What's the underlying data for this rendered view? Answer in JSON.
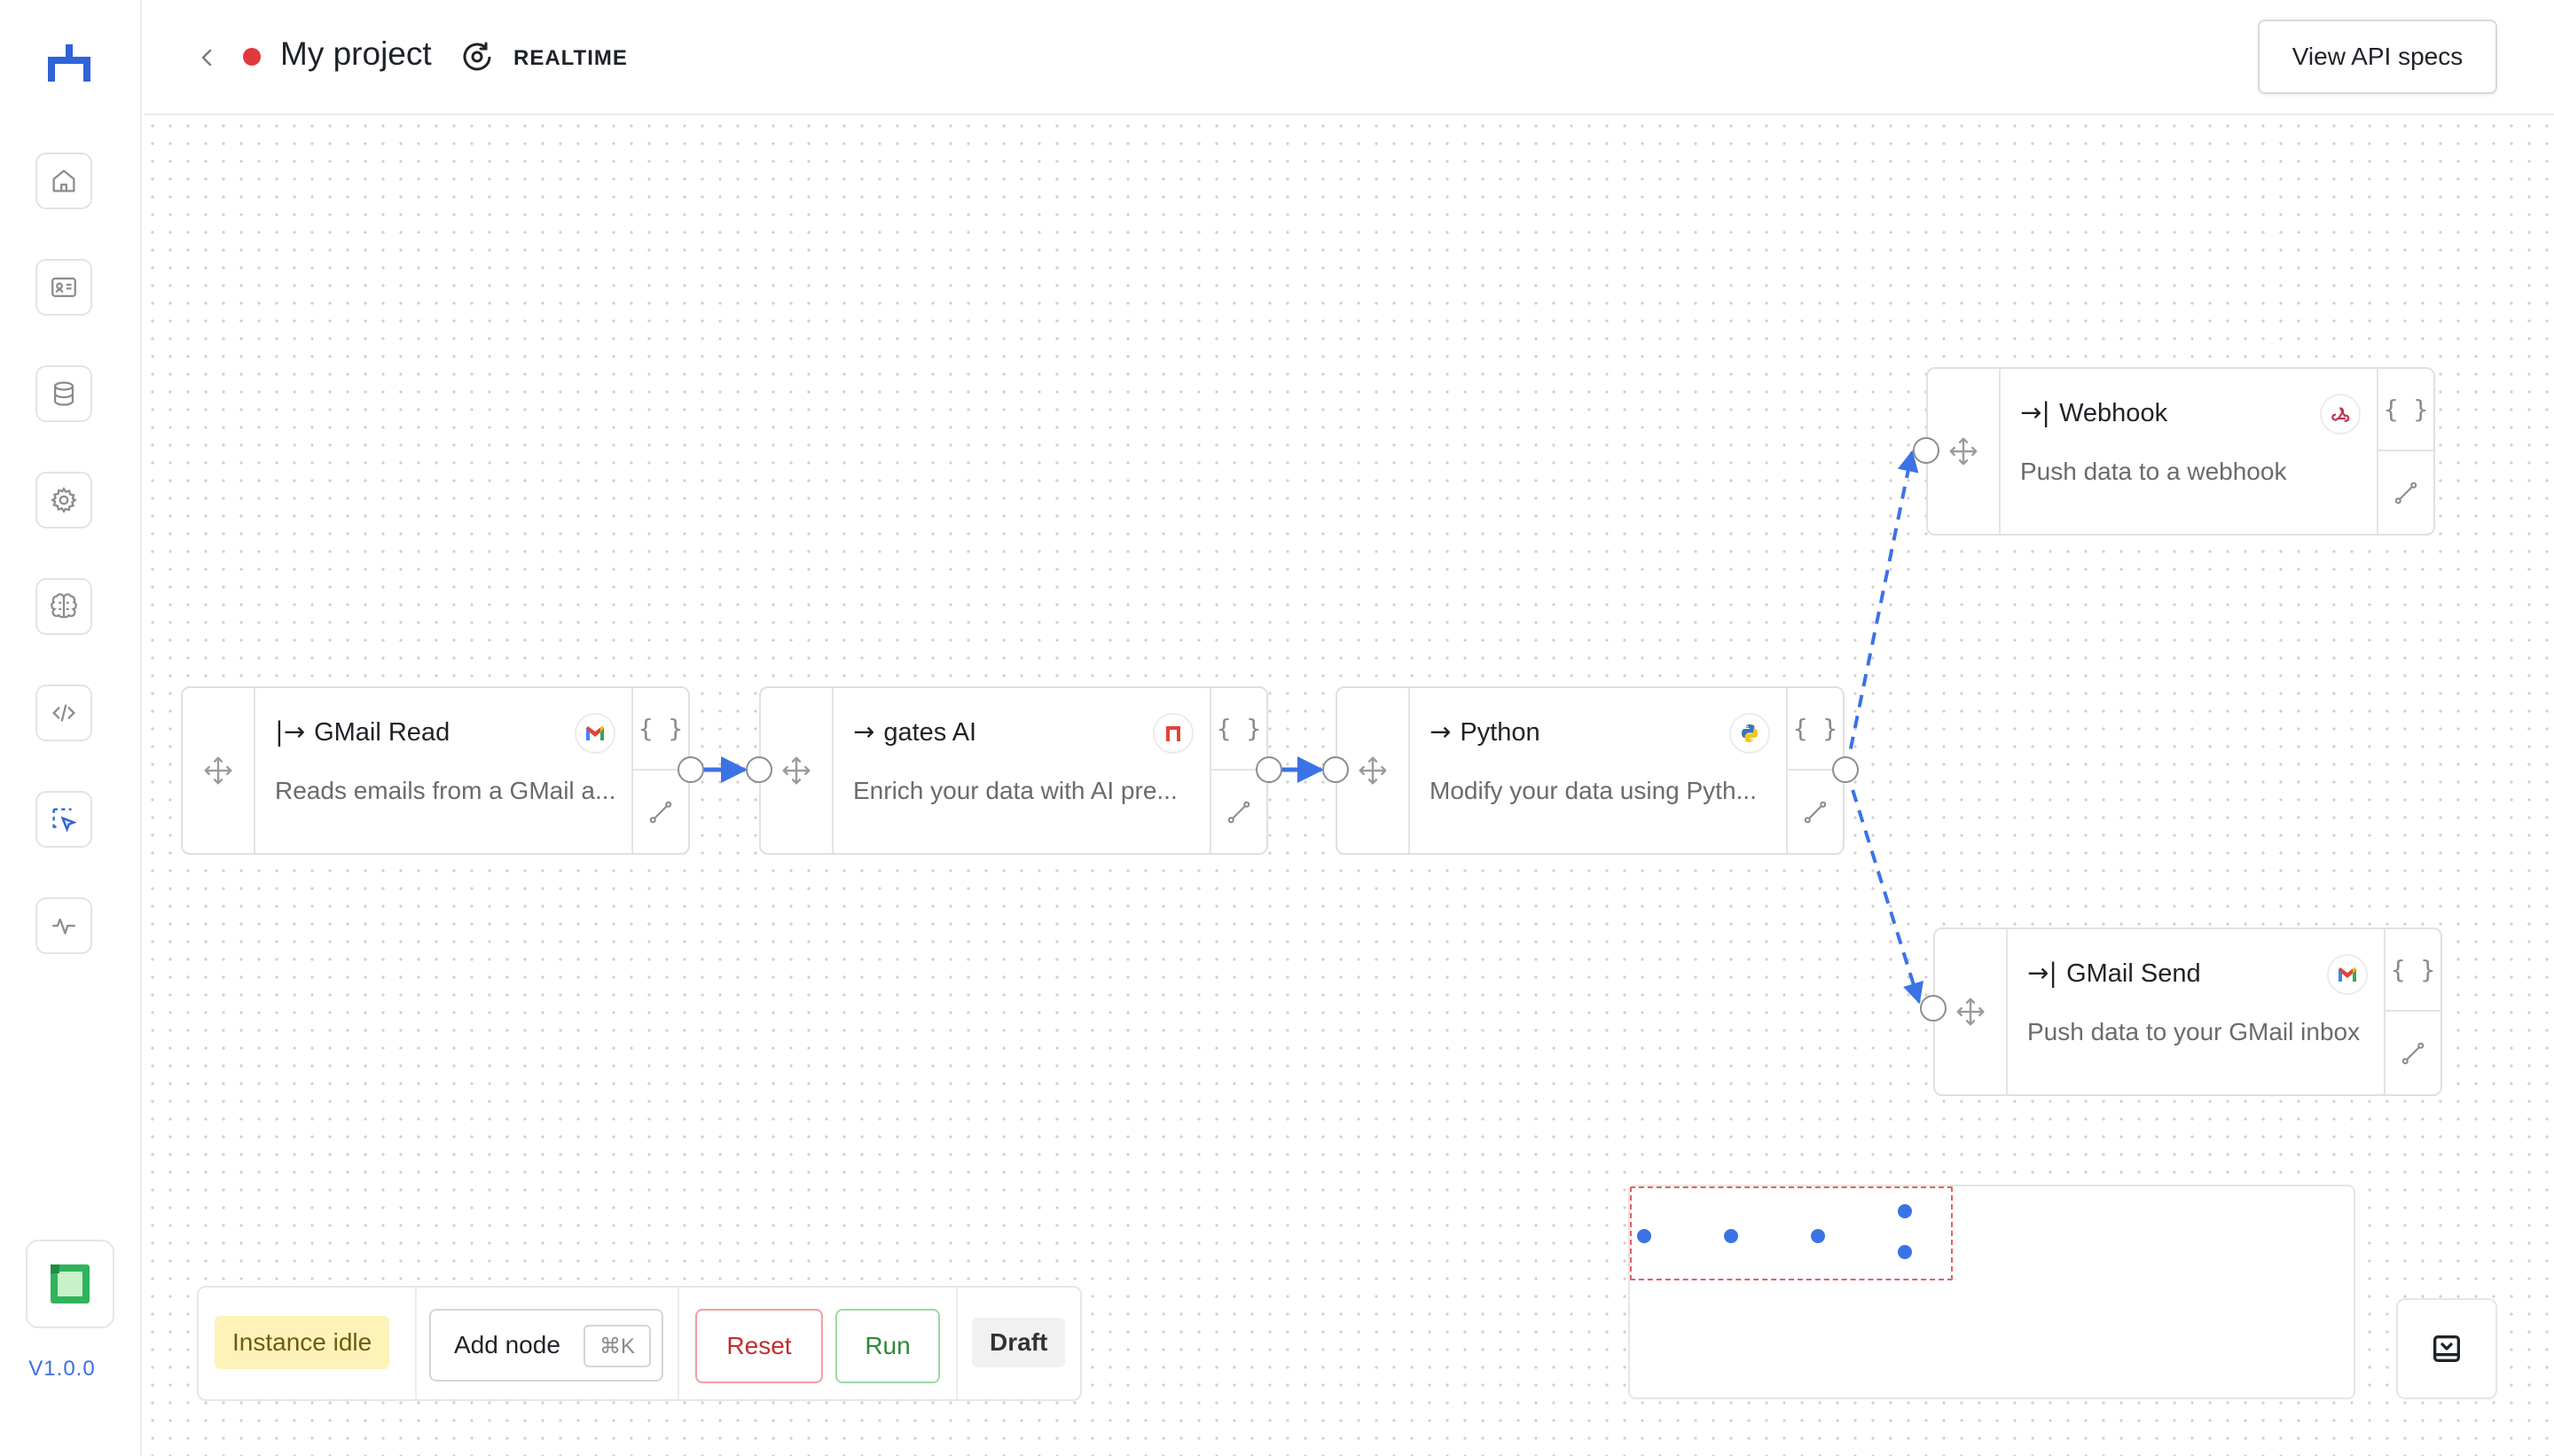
{
  "app": {
    "version": "V1.0.0",
    "project_title": "My project",
    "status_color": "#e0393e",
    "mode_label": "REALTIME",
    "api_button_label": "View API specs"
  },
  "sidebar": {
    "items": [
      {
        "name": "home",
        "icon": "home-icon"
      },
      {
        "name": "cards",
        "icon": "id-card-icon"
      },
      {
        "name": "database",
        "icon": "database-icon"
      },
      {
        "name": "settings",
        "icon": "gear-icon"
      },
      {
        "name": "brain",
        "icon": "brain-icon"
      },
      {
        "name": "code",
        "icon": "code-icon"
      },
      {
        "name": "selector",
        "icon": "select-pointer-icon",
        "active": true
      },
      {
        "name": "activity",
        "icon": "activity-icon"
      }
    ]
  },
  "nodes": [
    {
      "id": "gmail-read",
      "arrow": "|→",
      "title": "GMail Read",
      "desc": "Reads emails from a GMail a...",
      "service_icon": "gmail-icon"
    },
    {
      "id": "gates-ai",
      "arrow": "→",
      "title": "gates AI",
      "desc": "Enrich your data with AI pre...",
      "service_icon": "gates-ai-icon"
    },
    {
      "id": "python",
      "arrow": "→",
      "title": "Python",
      "desc": "Modify your data using Pyth...",
      "service_icon": "python-icon"
    },
    {
      "id": "webhook",
      "arrow": "→|",
      "title": "Webhook",
      "desc": "Push data to a webhook",
      "service_icon": "webhook-icon"
    },
    {
      "id": "gmail-send",
      "arrow": "→|",
      "title": "GMail Send",
      "desc": "Push data to your GMail inbox",
      "service_icon": "gmail-icon"
    }
  ],
  "node_side": {
    "brace": "{ }"
  },
  "toolbar": {
    "status": "Instance idle",
    "add_node": "Add node",
    "shortcut": "⌘K",
    "reset": "Reset",
    "run": "Run",
    "draft": "Draft"
  },
  "colors": {
    "accent": "#3b73e6",
    "edge": "#3b73e6",
    "idle_badge_bg": "#fdf3b8",
    "reset": "#c22d2d",
    "run": "#2c8a36"
  }
}
